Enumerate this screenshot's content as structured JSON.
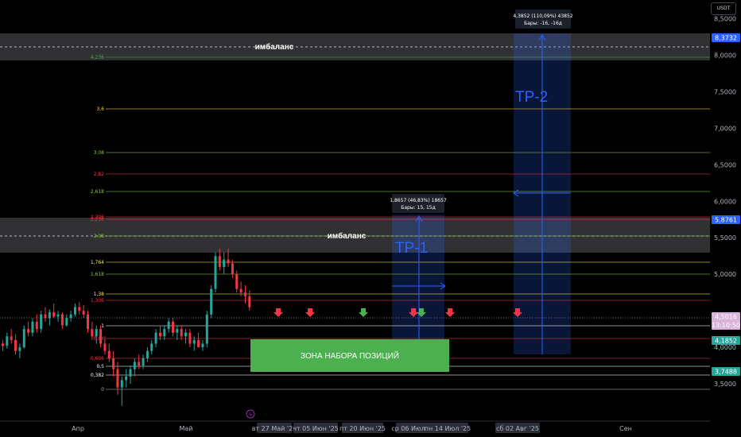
{
  "currency": "USDT",
  "price_axis_ticks": [
    "8,5000",
    "8,0000",
    "7,5000",
    "7,0000",
    "6,5000",
    "6,0000",
    "5,5000",
    "5,0000",
    "4,0000",
    "3,5000"
  ],
  "date_axis": {
    "months": [
      "Апр",
      "Май",
      "Сен"
    ],
    "highlighted": [
      "вт 27 Май '25",
      "чт 05 Июн '25",
      "пт 20 Июн '25",
      "ср 06 Июл '25",
      "пн 14 Июл '25",
      "сб 02 Авг '25"
    ]
  },
  "price_tags": [
    {
      "label": "8,3732",
      "color": "#2962ff"
    },
    {
      "label": "5,8761",
      "color": "#2962ff"
    },
    {
      "label": "4,5016",
      "sub": "13:10:50",
      "color": "#d9b3d9",
      "text_color": "#131722"
    },
    {
      "label": "4,1852",
      "color": "#26a69a"
    },
    {
      "label": "3,7488",
      "color": "#26a69a"
    }
  ],
  "fib_levels": [
    {
      "label": "4,236",
      "color": "#4caf50"
    },
    {
      "label": "3,6",
      "color": "#ffd54f"
    },
    {
      "label": "3.08",
      "color": "#8bc34a"
    },
    {
      "label": "2.82",
      "color": "#f23645"
    },
    {
      "label": "2,618",
      "color": "#8bc34a"
    },
    {
      "label": "2,306",
      "color": "#f23645"
    },
    {
      "label": "2,236",
      "color": "#f23645"
    },
    {
      "label": "2.08",
      "color": "#8bc34a"
    },
    {
      "label": "1,764",
      "color": "#ffeb3b"
    },
    {
      "label": "1,618",
      "color": "#8bc34a"
    },
    {
      "label": "1,38",
      "color": "#ffeb3b"
    },
    {
      "label": "1,306",
      "color": "#f23645"
    },
    {
      "label": "1",
      "color": "#ffffff"
    },
    {
      "label": "0,84",
      "color": "#f23645"
    },
    {
      "label": "0,606",
      "color": "#f23645"
    },
    {
      "label": "0,5",
      "color": "#ffffff"
    },
    {
      "label": "0,382",
      "color": "#ffffff"
    },
    {
      "label": "0",
      "color": "#b2b5be"
    }
  ],
  "annotations": {
    "imbalance_top": "имбаланс",
    "imbalance_mid": "имбаланс",
    "accumulation_zone": "ЗОНА НАБОРА ПОЗИЦИЙ",
    "tp1": "TP-1",
    "tp2": "TP-2",
    "tp1_measure_line1": "1,8657 (46,83%) 18657",
    "tp1_measure_line2": "Бары: 15, 15д",
    "tp2_measure_line1": "4,3852 (110,09%) 43852",
    "tp2_measure_line2": "Бары: -16, -16д"
  },
  "colors": {
    "up": "#26a69a",
    "down": "#f23645",
    "accent": "#2962ff",
    "zone": "#4caf50",
    "background": "#000000"
  },
  "chart_data": {
    "type": "candlestick",
    "symbol_quote": "USDT",
    "ylim": [
      3.1,
      8.65
    ],
    "y_ticks": [
      3.5,
      4.0,
      5.0,
      5.5,
      6.0,
      6.5,
      7.0,
      7.5,
      8.0,
      8.5
    ],
    "last_price": 4.5016,
    "candles": [
      [
        4.05,
        4.1,
        3.95,
        4.02
      ],
      [
        4.02,
        4.2,
        3.98,
        4.15
      ],
      [
        4.15,
        4.25,
        4.05,
        4.1
      ],
      [
        4.1,
        4.18,
        3.9,
        3.95
      ],
      [
        3.95,
        4.05,
        3.85,
        4.0
      ],
      [
        4.0,
        4.3,
        3.98,
        4.25
      ],
      [
        4.25,
        4.35,
        4.15,
        4.2
      ],
      [
        4.2,
        4.4,
        4.15,
        4.35
      ],
      [
        4.35,
        4.45,
        4.2,
        4.25
      ],
      [
        4.25,
        4.5,
        4.2,
        4.45
      ],
      [
        4.45,
        4.55,
        4.35,
        4.4
      ],
      [
        4.4,
        4.52,
        4.3,
        4.48
      ],
      [
        4.48,
        4.6,
        4.4,
        4.42
      ],
      [
        4.42,
        4.5,
        4.35,
        4.45
      ],
      [
        4.45,
        4.48,
        4.25,
        4.3
      ],
      [
        4.3,
        4.45,
        4.28,
        4.4
      ],
      [
        4.4,
        4.5,
        4.35,
        4.45
      ],
      [
        4.45,
        4.6,
        4.42,
        4.55
      ],
      [
        4.55,
        4.62,
        4.45,
        4.5
      ],
      [
        4.5,
        4.58,
        4.4,
        4.45
      ],
      [
        4.45,
        4.5,
        4.2,
        4.25
      ],
      [
        4.25,
        4.35,
        4.1,
        4.15
      ],
      [
        4.15,
        4.3,
        4.05,
        4.25
      ],
      [
        4.25,
        4.3,
        4.0,
        4.05
      ],
      [
        4.05,
        4.15,
        3.9,
        3.95
      ],
      [
        3.95,
        4.05,
        3.8,
        3.85
      ],
      [
        3.85,
        3.95,
        3.6,
        3.7
      ],
      [
        3.7,
        3.8,
        3.35,
        3.45
      ],
      [
        3.45,
        3.6,
        3.2,
        3.55
      ],
      [
        3.55,
        3.7,
        3.45,
        3.6
      ],
      [
        3.6,
        3.75,
        3.5,
        3.7
      ],
      [
        3.7,
        3.85,
        3.6,
        3.8
      ],
      [
        3.8,
        3.9,
        3.7,
        3.75
      ],
      [
        3.75,
        3.9,
        3.7,
        3.85
      ],
      [
        3.85,
        4.0,
        3.8,
        3.95
      ],
      [
        3.95,
        4.1,
        3.9,
        4.05
      ],
      [
        4.05,
        4.25,
        4.0,
        4.2
      ],
      [
        4.2,
        4.3,
        4.1,
        4.15
      ],
      [
        4.15,
        4.3,
        4.1,
        4.25
      ],
      [
        4.25,
        4.4,
        4.2,
        4.35
      ],
      [
        4.35,
        4.4,
        4.15,
        4.2
      ],
      [
        4.2,
        4.3,
        4.1,
        4.25
      ],
      [
        4.25,
        4.3,
        4.1,
        4.15
      ],
      [
        4.15,
        4.25,
        4.05,
        4.2
      ],
      [
        4.2,
        4.25,
        4.0,
        4.05
      ],
      [
        4.05,
        4.15,
        3.95,
        4.1
      ],
      [
        4.1,
        4.2,
        4.0,
        4.0
      ],
      [
        4.0,
        4.1,
        3.95,
        4.05
      ],
      [
        4.05,
        4.5,
        4.0,
        4.45
      ],
      [
        4.45,
        4.85,
        4.4,
        4.8
      ],
      [
        4.8,
        5.3,
        4.75,
        5.25
      ],
      [
        5.25,
        5.35,
        5.05,
        5.1
      ],
      [
        5.1,
        5.3,
        5.0,
        5.2
      ],
      [
        5.2,
        5.35,
        5.1,
        5.15
      ],
      [
        5.15,
        5.2,
        4.95,
        5.0
      ],
      [
        5.0,
        5.05,
        4.75,
        4.8
      ],
      [
        4.8,
        4.9,
        4.7,
        4.75
      ],
      [
        4.75,
        4.85,
        4.6,
        4.7
      ],
      [
        4.7,
        4.78,
        4.5,
        4.55
      ]
    ]
  }
}
